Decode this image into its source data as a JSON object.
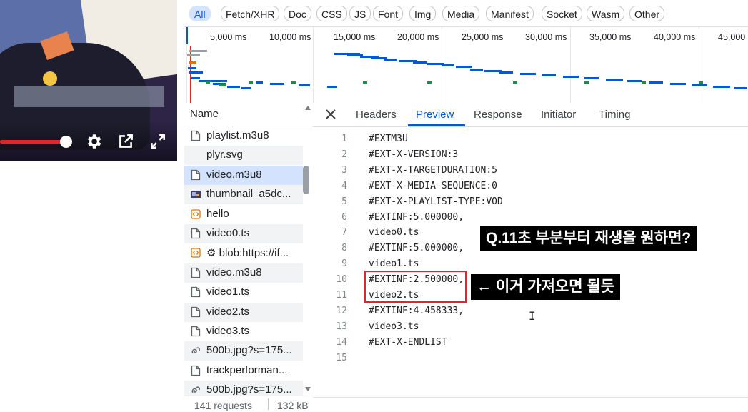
{
  "player": {
    "controls": [
      "gear-icon",
      "popout-icon",
      "fullscreen-icon"
    ],
    "progress_fraction": 0.37,
    "accent": "#e0262b"
  },
  "filters": [
    {
      "label": "All",
      "active": true
    },
    {
      "label": "Fetch/XHR",
      "active": false
    },
    {
      "label": "Doc",
      "active": false
    },
    {
      "label": "CSS",
      "active": false
    },
    {
      "label": "JS",
      "active": false
    },
    {
      "label": "Font",
      "active": false
    },
    {
      "label": "Img",
      "active": false
    },
    {
      "label": "Media",
      "active": false
    },
    {
      "label": "Manifest",
      "active": false
    },
    {
      "label": "Socket",
      "active": false
    },
    {
      "label": "Wasm",
      "active": false
    },
    {
      "label": "Other",
      "active": false
    }
  ],
  "timeline": {
    "ticks": [
      "5,000 ms",
      "10,000 ms",
      "15,000 ms",
      "20,000 ms",
      "25,000 ms",
      "30,000 ms",
      "35,000 ms",
      "40,000 ms",
      "45,000"
    ]
  },
  "requests": {
    "header": "Name",
    "rows": [
      {
        "name": "playlist.m3u8",
        "icon": "document-icon"
      },
      {
        "name": "plyr.svg",
        "icon": "none"
      },
      {
        "name": "video.m3u8",
        "icon": "document-icon",
        "selected": true
      },
      {
        "name": "thumbnail_a5dc...",
        "icon": "image-thumbnail-icon"
      },
      {
        "name": "hello",
        "icon": "script-icon"
      },
      {
        "name": "video0.ts",
        "icon": "document-icon"
      },
      {
        "name": "⚙ blob:https://if...",
        "icon": "script-icon"
      },
      {
        "name": "video.m3u8",
        "icon": "document-icon"
      },
      {
        "name": "video1.ts",
        "icon": "document-icon"
      },
      {
        "name": "video2.ts",
        "icon": "document-icon"
      },
      {
        "name": "video3.ts",
        "icon": "document-icon"
      },
      {
        "name": "500b.jpg?s=175...",
        "icon": "image-link-icon"
      },
      {
        "name": "trackperforman...",
        "icon": "document-icon"
      },
      {
        "name": "500b.jpg?s=175...",
        "icon": "image-link-icon"
      }
    ],
    "status": {
      "requests": "141 requests",
      "size": "132 kB"
    }
  },
  "detail": {
    "tabs": [
      {
        "label": "Headers",
        "active": false
      },
      {
        "label": "Preview",
        "active": true
      },
      {
        "label": "Response",
        "active": false
      },
      {
        "label": "Initiator",
        "active": false
      },
      {
        "label": "Timing",
        "active": false
      }
    ],
    "lines": [
      {
        "n": "1",
        "text": "#EXTM3U"
      },
      {
        "n": "2",
        "text": "#EXT-X-VERSION:3"
      },
      {
        "n": "3",
        "text": "#EXT-X-TARGETDURATION:5"
      },
      {
        "n": "4",
        "text": "#EXT-X-MEDIA-SEQUENCE:0"
      },
      {
        "n": "5",
        "text": "#EXT-X-PLAYLIST-TYPE:VOD"
      },
      {
        "n": "6",
        "text": "#EXTINF:5.000000,"
      },
      {
        "n": "7",
        "text": "video0.ts"
      },
      {
        "n": "8",
        "text": "#EXTINF:5.000000,"
      },
      {
        "n": "9",
        "text": "video1.ts"
      },
      {
        "n": "10",
        "text": "#EXTINF:2.500000,"
      },
      {
        "n": "11",
        "text": "video2.ts"
      },
      {
        "n": "12",
        "text": "#EXTINF:4.458333,"
      },
      {
        "n": "13",
        "text": "video3.ts"
      },
      {
        "n": "14",
        "text": "#EXT-X-ENDLIST"
      },
      {
        "n": "15",
        "text": ""
      }
    ]
  },
  "annotations": {
    "question": "Q.11초 부분부터 재생을 원하면?",
    "answer": "← 이거 가져오면 될듯"
  },
  "colors": {
    "accent_blue": "#0b57d0",
    "selected_bg": "#d3e3fd",
    "highlight_red": "#e0262b"
  }
}
